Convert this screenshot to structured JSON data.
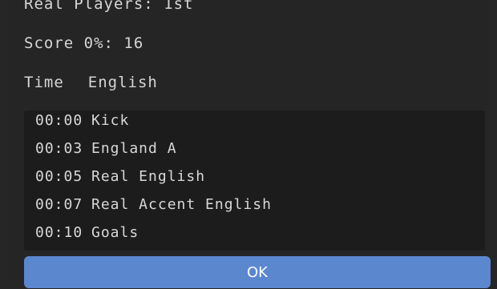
{
  "header": {
    "title": "Real Players: 1st",
    "score": "Score 0%: 16",
    "time_label": "Time",
    "time_value": "English"
  },
  "log": [
    {
      "time": "00:00",
      "text": "Kick"
    },
    {
      "time": "00:03",
      "text": "England A"
    },
    {
      "time": "00:05",
      "text": "Real English"
    },
    {
      "time": "00:07",
      "text": "Real Accent English"
    },
    {
      "time": "00:10",
      "text": "Goals"
    }
  ],
  "actions": {
    "ok_label": "OK"
  },
  "colors": {
    "background": "#262626",
    "log_background": "#1c1c1c",
    "button": "#5b87cf"
  }
}
